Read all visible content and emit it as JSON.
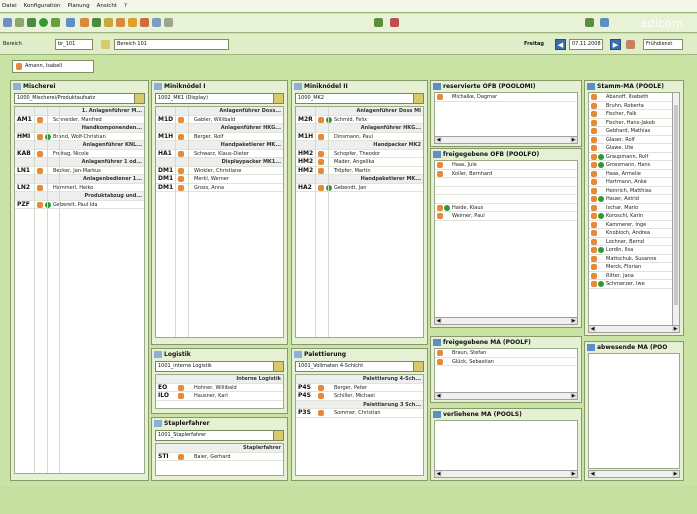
{
  "menu": [
    "Datei",
    "Konfiguration",
    "Planung",
    "Ansicht",
    "?"
  ],
  "brand": "adicom.",
  "filter": {
    "bereich_label": "Bereich",
    "bereich_code": "br_101",
    "bereich_name": "Bereich 101",
    "day": "Freitag",
    "date": "07.11.2008",
    "shift": "Frühdienst"
  },
  "user": "Amann, Isabell",
  "panels": {
    "mischerei": {
      "title": "Mischerei",
      "combo": "1000_Mischerei/Produktaufsatz",
      "rows": [
        {
          "type": "h",
          "text": "1. Anlagenführer M..."
        },
        {
          "type": "r",
          "code": "AM1",
          "pic": true,
          "plus": false,
          "name": "Schneider, Manfred"
        },
        {
          "type": "h",
          "text": "Handkomponenden..."
        },
        {
          "type": "r",
          "code": "HMI",
          "pic": true,
          "plus": true,
          "name": "Brand, Wolf-Christian"
        },
        {
          "type": "h",
          "text": "Anlagenführer KNL..."
        },
        {
          "type": "r",
          "code": "KAB",
          "pic": true,
          "plus": false,
          "name": "Freitag, Nicole"
        },
        {
          "type": "h",
          "text": "Anlagenführer 1 od..."
        },
        {
          "type": "r",
          "code": "LN1",
          "pic": true,
          "plus": false,
          "name": "Becker, Jan-Markus"
        },
        {
          "type": "h",
          "text": "Anlagenbediener 1..."
        },
        {
          "type": "r",
          "code": "LN2",
          "pic": true,
          "plus": false,
          "name": "Hammerl, Heiko"
        },
        {
          "type": "h",
          "text": "Produktabzug und..."
        },
        {
          "type": "r",
          "code": "PZF",
          "pic": true,
          "plus": true,
          "name": "Gebereit, Paul Ida"
        }
      ]
    },
    "minikoedel1": {
      "title": "Miniknödel I",
      "combo": "1002_MK1 (Display)",
      "rows": [
        {
          "type": "h",
          "text": "Anlagenführer Doss..."
        },
        {
          "type": "r",
          "code": "M1D",
          "pic": true,
          "plus": false,
          "name": "Gabler, Willibald"
        },
        {
          "type": "h",
          "text": "Anlagenführer HKG..."
        },
        {
          "type": "r",
          "code": "M1H",
          "pic": true,
          "plus": false,
          "name": "Berger, Rolf"
        },
        {
          "type": "h",
          "text": "Handpaketierer MK..."
        },
        {
          "type": "r",
          "code": "HA1",
          "pic": true,
          "plus": false,
          "name": "Schwarz, Klaus-Dieter"
        },
        {
          "type": "h",
          "text": "Displaypacker MK1..."
        },
        {
          "type": "r",
          "code": "DM1",
          "pic": true,
          "plus": false,
          "name": "Winkler, Christiane"
        },
        {
          "type": "r",
          "code": "DM1",
          "pic": true,
          "plus": false,
          "name": "Merkl, Werner"
        },
        {
          "type": "r",
          "code": "DM1",
          "pic": true,
          "plus": false,
          "name": "Gross, Anna"
        }
      ]
    },
    "minikoedel2": {
      "title": "Miniknödel II",
      "combo": "1000_MK2",
      "rows": [
        {
          "type": "h",
          "text": "Anlagenführer Doss MI"
        },
        {
          "type": "r",
          "code": "M2R",
          "pic": true,
          "plus": true,
          "name": "Schmid, Felix"
        },
        {
          "type": "h",
          "text": "Anlagenführer HKG..."
        },
        {
          "type": "r",
          "code": "M1H",
          "pic": true,
          "plus": false,
          "name": "Dinsmann, Paul"
        },
        {
          "type": "h",
          "text": "Handpacker MK2"
        },
        {
          "type": "r",
          "code": "HM2",
          "pic": true,
          "plus": false,
          "name": "Schopfer, Theodor"
        },
        {
          "type": "r",
          "code": "HM2",
          "pic": true,
          "plus": false,
          "name": "Mader, Angelika"
        },
        {
          "type": "r",
          "code": "HM2",
          "pic": true,
          "plus": false,
          "name": "Tröpfer, Martin"
        },
        {
          "type": "h",
          "text": "Handpaketierer MK..."
        },
        {
          "type": "r",
          "code": "HA2",
          "pic": true,
          "plus": true,
          "name": "Gebendt, Jan"
        }
      ]
    },
    "logistik": {
      "title": "Logistik",
      "combo": "1001_interne Logistik",
      "rows": [
        {
          "type": "h",
          "text": "Interne Logistik"
        },
        {
          "type": "r",
          "code": "EO",
          "pic": true,
          "plus": false,
          "name": "Hohner, Willibald"
        },
        {
          "type": "r",
          "code": "ILO",
          "pic": true,
          "plus": false,
          "name": "Hausner, Karl"
        }
      ]
    },
    "staplerfahrer": {
      "title": "Staplerfahrer",
      "combo": "1001_Staplerfahrer",
      "rows": [
        {
          "type": "h",
          "text": "Staplerfahrer"
        },
        {
          "type": "r",
          "code": "STI",
          "pic": true,
          "plus": false,
          "name": "Baier, Gerhard"
        }
      ]
    },
    "palettierung": {
      "title": "Palettierung",
      "combo": "1001_Vollmaten 4-Schicht",
      "rows": [
        {
          "type": "h",
          "text": "Palettierung 4-Sch..."
        },
        {
          "type": "r",
          "code": "P4S",
          "pic": true,
          "plus": false,
          "name": "Berger, Peter"
        },
        {
          "type": "r",
          "code": "P4S",
          "pic": true,
          "plus": false,
          "name": "Schiller, Michael"
        },
        {
          "type": "h",
          "text": "Palettierung 3 Sch..."
        },
        {
          "type": "r",
          "code": "P3S",
          "pic": true,
          "plus": false,
          "name": "Sommer, Christian"
        }
      ]
    },
    "reserviert": {
      "title": "reservierte OFB (POOLOMI)",
      "names": [
        "Michalke, Dagmar"
      ]
    },
    "freigegebene_ofb": {
      "title": "freigegebene OFB (POOLFO)",
      "names": [
        "Haas, Jule",
        "Koller, Bernhard",
        "",
        "",
        "",
        "Haide, Klaus",
        "Weimer, Paul"
      ],
      "plus": [
        false,
        false,
        false,
        false,
        false,
        true,
        false
      ]
    },
    "freigegebene_ma": {
      "title": "freigegebene MA (POOLF)",
      "names": [
        "Braun, Stefan",
        "Glück, Sebastian"
      ]
    },
    "verliehene": {
      "title": "verliehene MA (POOLS)"
    },
    "stamm": {
      "title": "Stamm-MA (POOLE)",
      "names": [
        "Abanoff, Ilsebeth",
        "Bruhn, Roberta",
        "Fischer, Falk",
        "Fischer, Hans-Jakob",
        "Gebhard, Mathias",
        "Glaser, Rolf",
        "Glawe, Ute",
        "Graupmann, Rolf",
        "Grossmann, Hans",
        "Haas, Armelie",
        "Hartmann, Anke",
        "Heinrich, Matthias",
        "Hauer, Astrid",
        "Ischar, Mario",
        "Koroschi, Karin",
        "Kammerer, Inge",
        "Knobloch, Andrea",
        "Lochner, Bernd",
        "Lordin, Ilsa",
        "Mattschuk, Susanne",
        "Merck, Florian",
        "Ritter, Jana",
        "Schmerzer, Iwe"
      ],
      "plus": [
        false,
        false,
        false,
        false,
        false,
        false,
        false,
        true,
        true,
        false,
        false,
        false,
        true,
        false,
        true,
        false,
        false,
        false,
        true,
        false,
        false,
        false,
        true
      ]
    },
    "abwesend": {
      "title": "abwesende MA (POO"
    }
  }
}
